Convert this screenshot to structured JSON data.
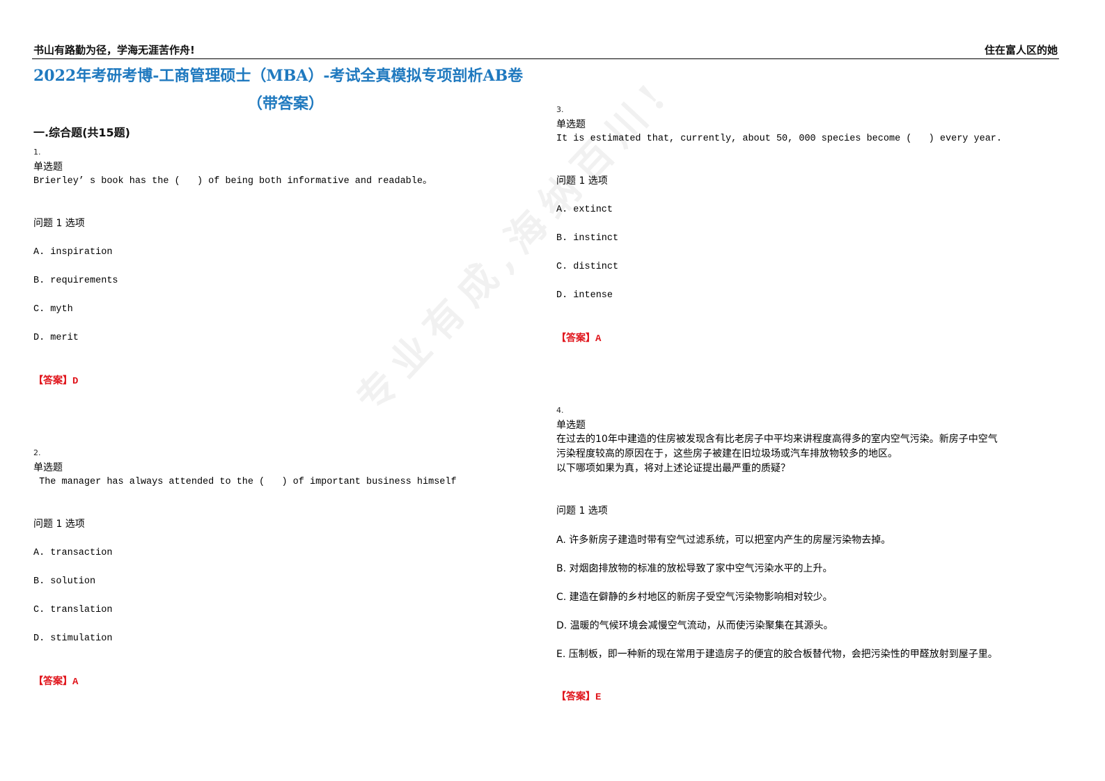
{
  "header": {
    "left_motto": "书山有路勤为径，学海无涯苦作舟!",
    "right_text": "住在富人区的她"
  },
  "document": {
    "title": "2022年考研考博-工商管理硕士（MBA）-考试全真模拟专项剖析AB卷",
    "subtitle": "（带答案）",
    "section_heading": "一.综合题(共15题)"
  },
  "watermark": "专业有成,海纳百川!",
  "questions": [
    {
      "number": "1.",
      "type": "单选题",
      "stem": "Brierley’ s book has the (   ) of being both informative and readable。",
      "options_label": "问题 1 选项",
      "options": [
        "A. inspiration",
        "B. requirements",
        "C. myth",
        "D. merit"
      ],
      "answer_label": "【答案】",
      "answer": "D"
    },
    {
      "number": "2.",
      "type": "单选题",
      "stem": " The manager has always attended to the (   ) of important business himself",
      "options_label": "问题 1 选项",
      "options": [
        "A. transaction",
        "B. solution",
        "C. translation",
        "D. stimulation"
      ],
      "answer_label": "【答案】",
      "answer": "A"
    },
    {
      "number": "3.",
      "type": "单选题",
      "stem": "It is estimated that, currently, about 50, 000 species become (   ) every year.",
      "options_label": "问题 1 选项",
      "options": [
        "A. extinct",
        "B. instinct",
        "C. distinct",
        "D. intense"
      ],
      "answer_label": "【答案】",
      "answer": "A"
    },
    {
      "number": "4.",
      "type": "单选题",
      "stem_lines": [
        "在过去的10年中建造的住房被发现含有比老房子中平均来讲程度高得多的室内空气污染。新房子中空气",
        "污染程度较高的原因在于，这些房子被建在旧垃圾场或汽车排放物较多的地区。",
        "以下哪项如果为真，将对上述论证提出最严重的质疑？"
      ],
      "options_label": "问题 1 选项",
      "options": [
        "A. 许多新房子建造时带有空气过滤系统，可以把室内产生的房屋污染物去掉。",
        "B. 对烟囱排放物的标准的放松导致了家中空气污染水平的上升。",
        "C. 建造在僻静的乡村地区的新房子受空气污染物影响相对较少。",
        "D. 温暖的气候环境会减慢空气流动，从而使污染聚集在其源头。",
        "E. 压制板，即一种新的现在常用于建造房子的便宜的胶合板替代物，会把污染性的甲醛放射到屋子里。"
      ],
      "answer_label": "【答案】",
      "answer": "E"
    }
  ],
  "colors": {
    "title": "#1f79bf",
    "answer": "#e0141b"
  }
}
